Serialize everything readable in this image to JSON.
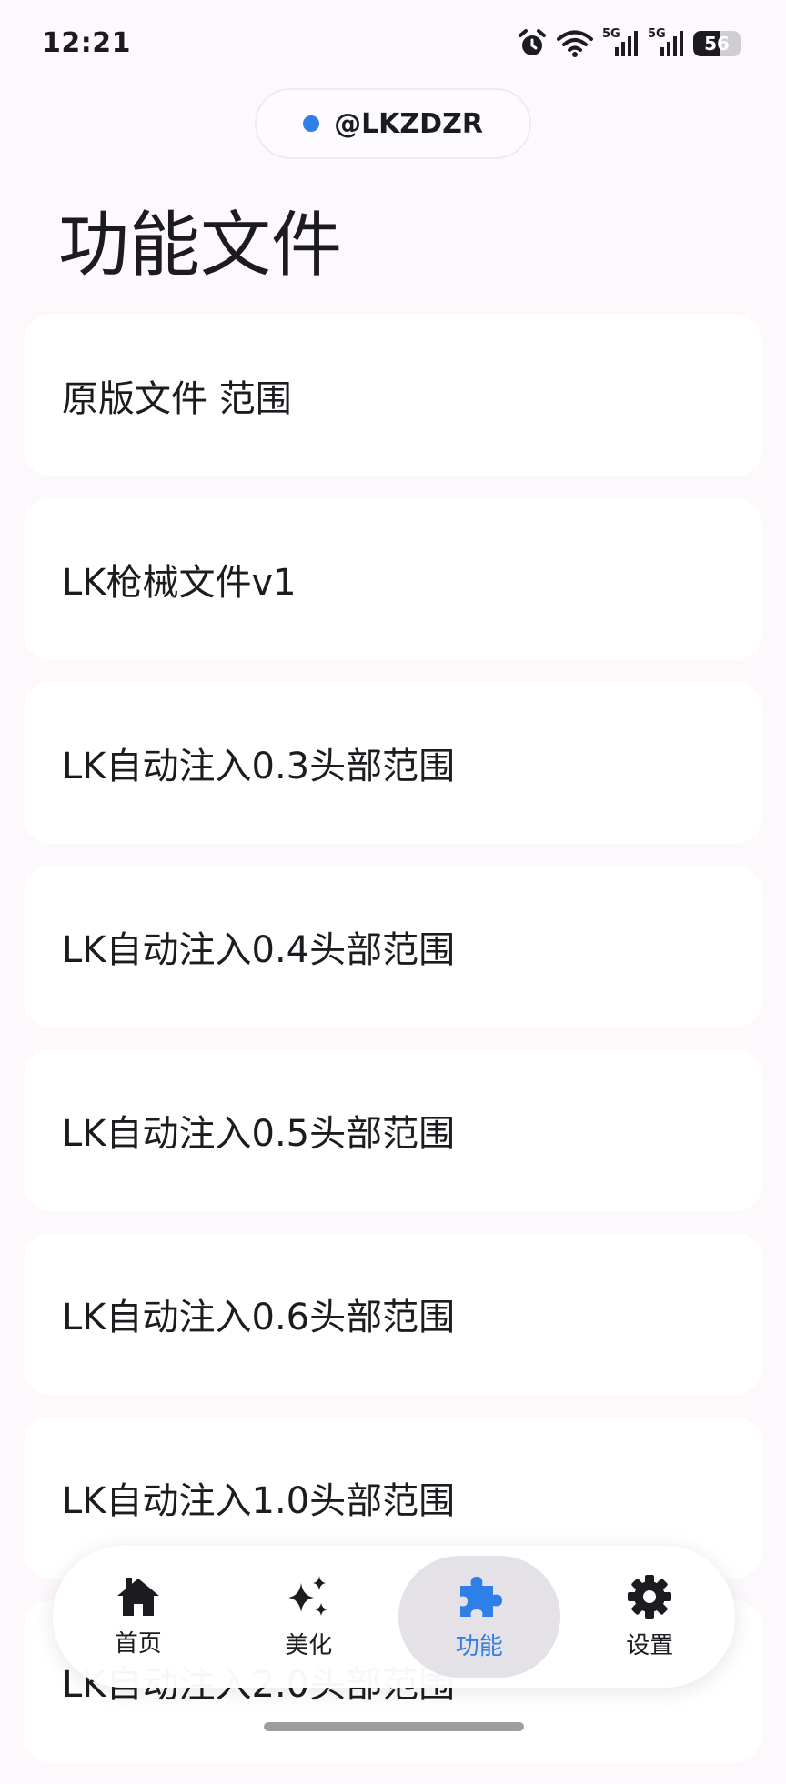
{
  "status_bar": {
    "time": "12:21",
    "signal_label_1": "5G",
    "signal_label_2": "5G",
    "battery_level": "56",
    "battery_percent": 56,
    "icons": [
      "alarm-icon",
      "wifi-icon",
      "signal-5g-icon",
      "signal-5g-icon",
      "battery-icon"
    ]
  },
  "user_chip": {
    "name": "@LKZDZR",
    "dot_color": "#2f7fe8"
  },
  "page": {
    "title": "功能文件"
  },
  "files": [
    {
      "label": "原版文件 范围"
    },
    {
      "label": "LK枪械文件v1"
    },
    {
      "label": "LK自动注入0.3头部范围"
    },
    {
      "label": "LK自动注入0.4头部范围"
    },
    {
      "label": "LK自动注入0.5头部范围"
    },
    {
      "label": "LK自动注入0.6头部范围"
    },
    {
      "label": "LK自动注入1.0头部范围"
    },
    {
      "label": "LK自动注入2.0头部范围"
    }
  ],
  "nav": {
    "items": [
      {
        "label": "首页",
        "icon": "home-icon",
        "active": false
      },
      {
        "label": "美化",
        "icon": "sparkle-icon",
        "active": false
      },
      {
        "label": "功能",
        "icon": "puzzle-icon",
        "active": true
      },
      {
        "label": "设置",
        "icon": "gear-icon",
        "active": false
      }
    ],
    "accent_color": "#2f7fe8"
  }
}
